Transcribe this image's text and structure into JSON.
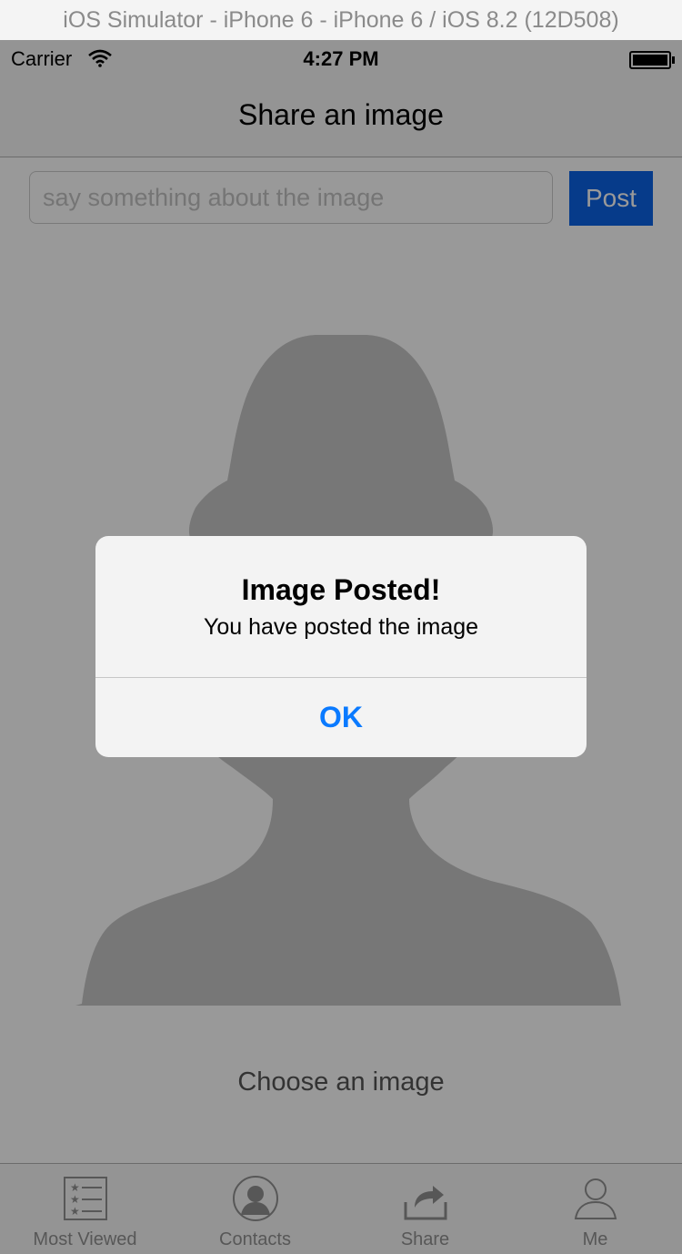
{
  "simulator": {
    "title": "iOS Simulator - iPhone 6 - iPhone 6 / iOS 8.2 (12D508)"
  },
  "status_bar": {
    "carrier": "Carrier",
    "time": "4:27 PM",
    "wifi_icon": "wifi-icon",
    "battery_icon": "battery-icon"
  },
  "nav": {
    "title": "Share an image"
  },
  "composer": {
    "placeholder": "say something about the image",
    "value": "",
    "post_label": "Post",
    "post_color": "#0a63e6"
  },
  "image_area": {
    "placeholder_icon": "person-silhouette-icon",
    "choose_label": "Choose an image"
  },
  "tab_bar": {
    "items": [
      {
        "label": "Most Viewed",
        "icon": "most-viewed-icon"
      },
      {
        "label": "Contacts",
        "icon": "contacts-icon"
      },
      {
        "label": "Share",
        "icon": "share-icon"
      },
      {
        "label": "Me",
        "icon": "me-icon"
      }
    ]
  },
  "alert": {
    "title": "Image Posted!",
    "message": "You have posted the image",
    "ok_label": "OK",
    "ok_color": "#0a7aff"
  }
}
